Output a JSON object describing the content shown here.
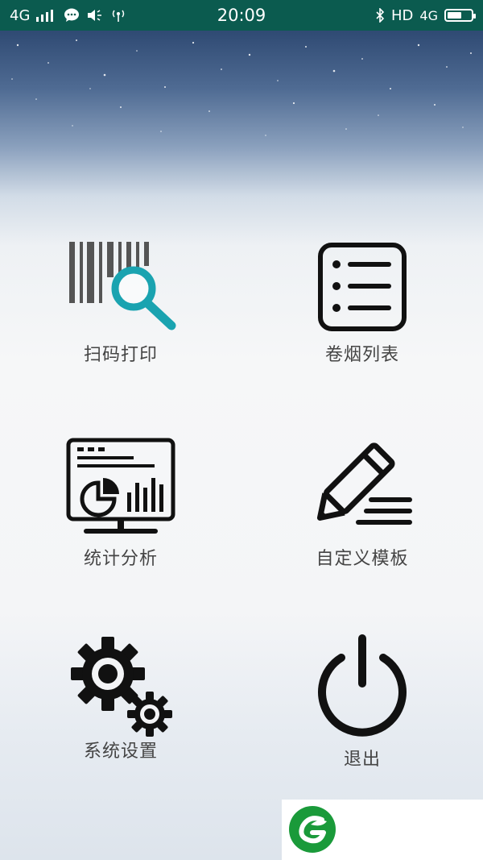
{
  "status_bar": {
    "network_left": "4G",
    "time": "20:09",
    "hd_label": "HD",
    "network_right": "4G",
    "battery_level": 0.6
  },
  "menu": {
    "items": [
      {
        "label": "扫码打印",
        "icon": "barcode-search-icon"
      },
      {
        "label": "卷烟列表",
        "icon": "list-icon"
      },
      {
        "label": "统计分析",
        "icon": "monitor-chart-icon"
      },
      {
        "label": "自定义模板",
        "icon": "pencil-edit-icon"
      },
      {
        "label": "系统设置",
        "icon": "gears-icon"
      },
      {
        "label": "退出",
        "icon": "power-icon"
      }
    ]
  },
  "brand": {
    "logo_icon": "leaf-g-logo-icon",
    "logo_color": "#1a9a3a",
    "accent_color": "#1aa3b0"
  }
}
